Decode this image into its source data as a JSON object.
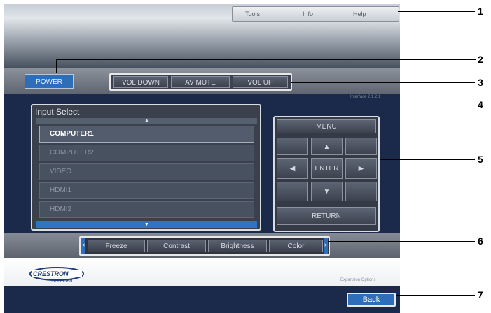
{
  "header_links": [
    "Tools",
    "Info",
    "Help"
  ],
  "controls": {
    "power": "POWER",
    "vol_down": "VOL DOWN",
    "av_mute": "AV MUTE",
    "vol_up": "VOL UP",
    "version": "Interface 2.1.2.1"
  },
  "input_select": {
    "title": "Input Select",
    "scroll_up": "▲",
    "scroll_down": "▼",
    "items": [
      "COMPUTER1",
      "COMPUTER2",
      "VIDEO",
      "HDMI1",
      "HDMI2"
    ],
    "selected": "COMPUTER1"
  },
  "navigation": {
    "menu": "MENU",
    "up": "▲",
    "left": "◀",
    "enter": "ENTER",
    "right": "▶",
    "down": "▼",
    "return": "RETURN"
  },
  "adjust": {
    "left_edge": "<",
    "right_edge": ">",
    "buttons": [
      "Freeze",
      "Contrast",
      "Brightness",
      "Color"
    ]
  },
  "footer": {
    "logo_line1": "CRESTRON",
    "logo_line2": "connected",
    "expansion": "Expansion Options",
    "back": "Back"
  },
  "callouts": [
    "1",
    "2",
    "3",
    "4",
    "5",
    "6",
    "7"
  ],
  "colors": {
    "navy": "#1b2a4a",
    "accent_blue": "#2e6eb8"
  }
}
